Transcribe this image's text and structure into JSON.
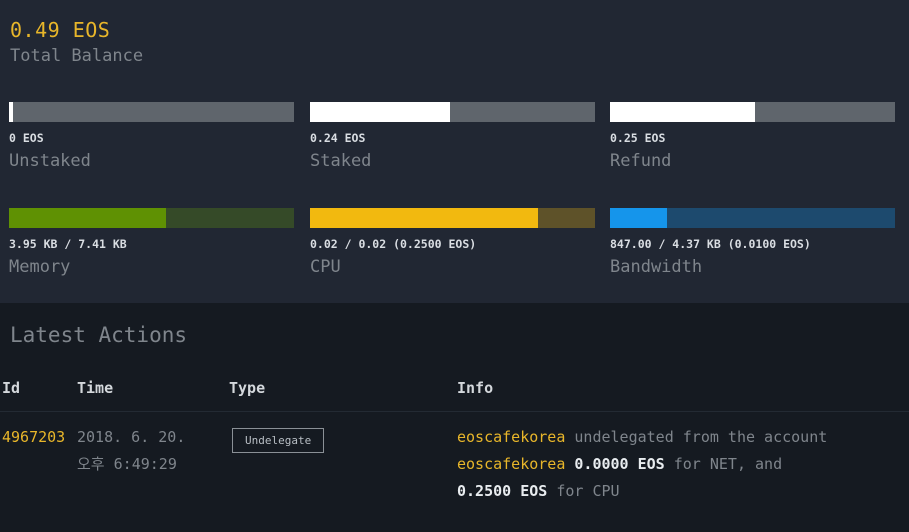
{
  "balance": {
    "value": "0.49 EOS",
    "label": "Total Balance"
  },
  "resources": {
    "unstaked": {
      "value": "0 EOS",
      "label": "Unstaked",
      "fill": 0.01,
      "fill_color": "#ffffff",
      "track_color": "#5f656c"
    },
    "staked": {
      "value": "0.24 EOS",
      "label": "Staked",
      "fill": 0.49,
      "fill_color": "#ffffff",
      "track_color": "#5f656c"
    },
    "refund": {
      "value": "0.25 EOS",
      "label": "Refund",
      "fill": 0.51,
      "fill_color": "#ffffff",
      "track_color": "#5f656c"
    },
    "memory": {
      "value": "3.95 KB / 7.41 KB",
      "label": "Memory",
      "fill": 0.55,
      "fill_color": "#5f9103",
      "track_color": "#354a28"
    },
    "cpu": {
      "value": "0.02 / 0.02 (0.2500 EOS)",
      "label": "CPU",
      "fill": 0.8,
      "fill_color": "#f2b90f",
      "track_color": "#5e5229"
    },
    "bandwidth": {
      "value": "847.00 / 4.37 KB (0.0100 EOS)",
      "label": "Bandwidth",
      "fill": 0.2,
      "fill_color": "#1595eb",
      "track_color": "#1d4a6e"
    }
  },
  "actions": {
    "title": "Latest Actions",
    "columns": {
      "id": "Id",
      "time": "Time",
      "type": "Type",
      "info": "Info"
    },
    "rows": [
      {
        "id": "4967203",
        "time_line1": "2018. 6. 20.",
        "time_line2": "오후 6:49:29",
        "type": "Undelegate",
        "info": {
          "account1": "eoscafekorea",
          "text1": " undelegated from the account",
          "account2": "eoscafekorea",
          "amount_net": "0.0000 EOS",
          "text2": " for NET, and",
          "amount_cpu": "0.2500 EOS",
          "text3": " for CPU"
        }
      }
    ]
  }
}
